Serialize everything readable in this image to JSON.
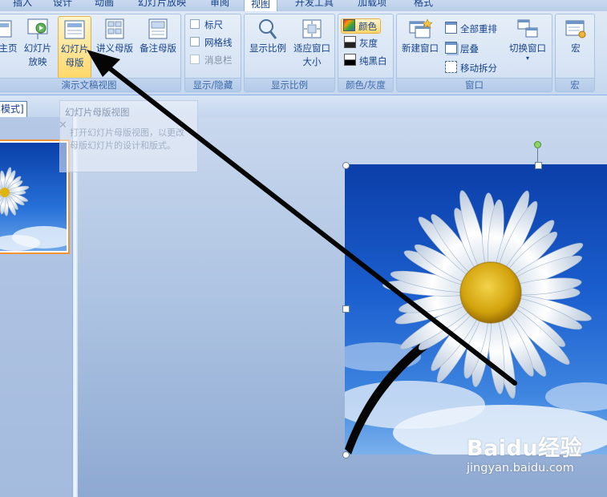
{
  "tabs": [
    "插入",
    "设计",
    "动画",
    "幻灯片放映",
    "审阅",
    "视图",
    "开发工具",
    "加载项",
    "格式"
  ],
  "groups": {
    "presentation_views": {
      "label": "演示文稿视图",
      "buttons": {
        "home_partial": "主页",
        "slideshow": "幻灯片放映",
        "slide_master": "幻灯片母版",
        "handout_master": "讲义母版",
        "notes_master": "备注母版"
      }
    },
    "show_hide": {
      "label": "显示/隐藏",
      "items": [
        "标尺",
        "网格线",
        "消息栏"
      ]
    },
    "zoom": {
      "label": "显示比例",
      "buttons": {
        "zoom": "显示比例",
        "fit_window": "适应窗口大小"
      }
    },
    "color_gray": {
      "label": "颜色/灰度",
      "items": [
        "颜色",
        "灰度",
        "纯黑白"
      ]
    },
    "window": {
      "label": "窗口",
      "buttons": {
        "new_window": "新建窗口",
        "arrange_all": "全部重排",
        "cascade": "层叠",
        "move_split": "移动拆分",
        "switch_windows": "切换窗口"
      }
    },
    "macros": {
      "label": "宏",
      "buttons": {
        "macros": "宏"
      }
    }
  },
  "view_mode_badge": "模式]",
  "tooltip": {
    "title": "幻灯片母版视图",
    "desc": "打开幻灯片母版视图，以更改母版幻灯片的设计和版式。"
  },
  "watermark": {
    "brand": "Baidu经验",
    "url": "jingyan.baidu.com"
  },
  "colors": {
    "accent_orange": "#f29436",
    "ribbon_text": "#15428b",
    "slide_sky": "#1b5fcf"
  }
}
